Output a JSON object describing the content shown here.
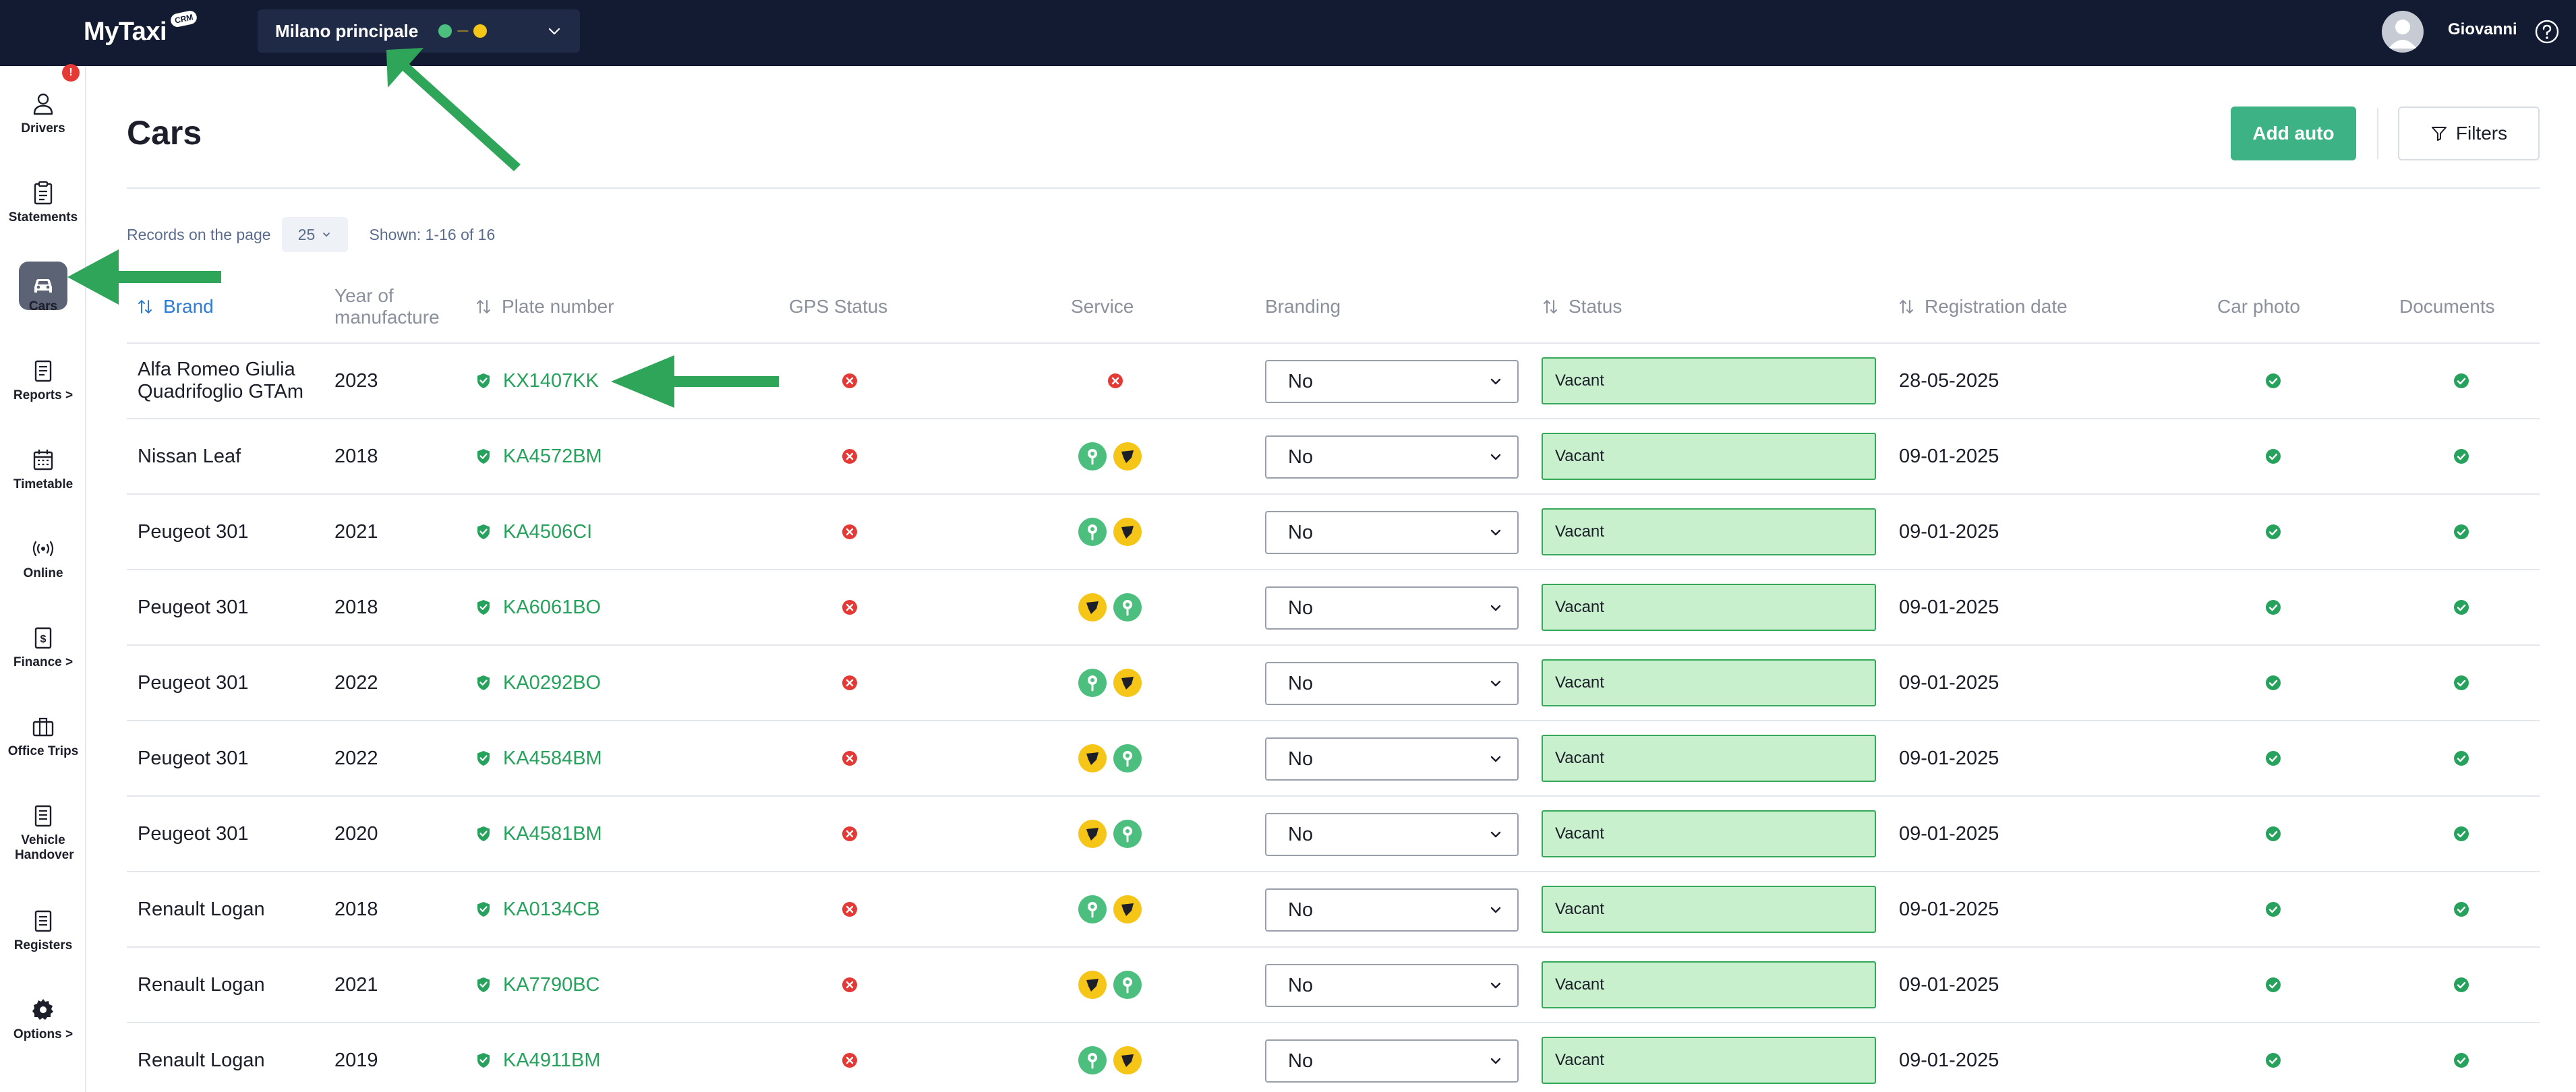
{
  "app": {
    "logo": "MyTaxi",
    "logo_badge": "CRM"
  },
  "branch": {
    "name": "Milano principale",
    "separator": "—"
  },
  "user": {
    "name": "Giovanni"
  },
  "sidebar": {
    "items": [
      {
        "label": "Drivers",
        "icon": "user-icon"
      },
      {
        "label": "Statements",
        "icon": "clipboard-icon",
        "badge": "!"
      },
      {
        "label": "Cars",
        "icon": "car-icon",
        "active": true
      },
      {
        "label": "Reports >",
        "icon": "document-icon"
      },
      {
        "label": "Timetable",
        "icon": "calendar-icon"
      },
      {
        "label": "Online",
        "icon": "broadcast-icon"
      },
      {
        "label": "Finance >",
        "icon": "money-document-icon"
      },
      {
        "label": "Office Trips",
        "icon": "briefcase-icon"
      },
      {
        "label": "Vehicle Handover",
        "icon": "handover-document-icon"
      },
      {
        "label": "Registers",
        "icon": "register-icon"
      },
      {
        "label": "Options >",
        "icon": "gear-icon"
      }
    ]
  },
  "page": {
    "title": "Cars",
    "add_button": "Add auto",
    "filters_button": "Filters",
    "records_label": "Records on the page",
    "per_page": "25",
    "shown": "Shown: 1-16 of 16"
  },
  "table": {
    "headers": {
      "brand": "Brand",
      "year": "Year of manufacture",
      "plate": "Plate number",
      "gps": "GPS Status",
      "service": "Service",
      "branding": "Branding",
      "status": "Status",
      "registration": "Registration date",
      "photo": "Car photo",
      "documents": "Documents"
    },
    "rows": [
      {
        "brand": "Alfa Romeo Giulia Quadrifoglio GTAm",
        "year": "2023",
        "plate": "KX1407KK",
        "service": [],
        "branding": "No",
        "status": "Vacant",
        "date": "28-05-2025"
      },
      {
        "brand": "Nissan Leaf",
        "year": "2018",
        "plate": "KA4572BM",
        "service": [
          "green",
          "yellow"
        ],
        "branding": "No",
        "status": "Vacant",
        "date": "09-01-2025"
      },
      {
        "brand": "Peugeot 301",
        "year": "2021",
        "plate": "KA4506CI",
        "service": [
          "green",
          "yellow"
        ],
        "branding": "No",
        "status": "Vacant",
        "date": "09-01-2025"
      },
      {
        "brand": "Peugeot 301",
        "year": "2018",
        "plate": "KA6061BO",
        "service": [
          "yellow",
          "green"
        ],
        "branding": "No",
        "status": "Vacant",
        "date": "09-01-2025"
      },
      {
        "brand": "Peugeot 301",
        "year": "2022",
        "plate": "KA0292BO",
        "service": [
          "green",
          "yellow"
        ],
        "branding": "No",
        "status": "Vacant",
        "date": "09-01-2025"
      },
      {
        "brand": "Peugeot 301",
        "year": "2022",
        "plate": "KA4584BM",
        "service": [
          "yellow",
          "green"
        ],
        "branding": "No",
        "status": "Vacant",
        "date": "09-01-2025"
      },
      {
        "brand": "Peugeot 301",
        "year": "2020",
        "plate": "KA4581BM",
        "service": [
          "yellow",
          "green"
        ],
        "branding": "No",
        "status": "Vacant",
        "date": "09-01-2025"
      },
      {
        "brand": "Renault Logan",
        "year": "2018",
        "plate": "KA0134CB",
        "service": [
          "green",
          "yellow"
        ],
        "branding": "No",
        "status": "Vacant",
        "date": "09-01-2025"
      },
      {
        "brand": "Renault Logan",
        "year": "2021",
        "plate": "KA7790BC",
        "service": [
          "yellow",
          "green"
        ],
        "branding": "No",
        "status": "Vacant",
        "date": "09-01-2025"
      },
      {
        "brand": "Renault Logan",
        "year": "2019",
        "plate": "KA4911BM",
        "service": [
          "green",
          "yellow"
        ],
        "branding": "No",
        "status": "Vacant",
        "date": "09-01-2025"
      }
    ]
  },
  "colors": {
    "topbar": "#131b33",
    "accent_green": "#3db284",
    "plate_green": "#27a25d",
    "status_fill": "#c8f0cc",
    "status_border": "#35a85a",
    "error_red": "#e53935",
    "service_yellow": "#f5c518",
    "service_green": "#4cbf7e",
    "annotation_arrow": "#2fa55a"
  }
}
